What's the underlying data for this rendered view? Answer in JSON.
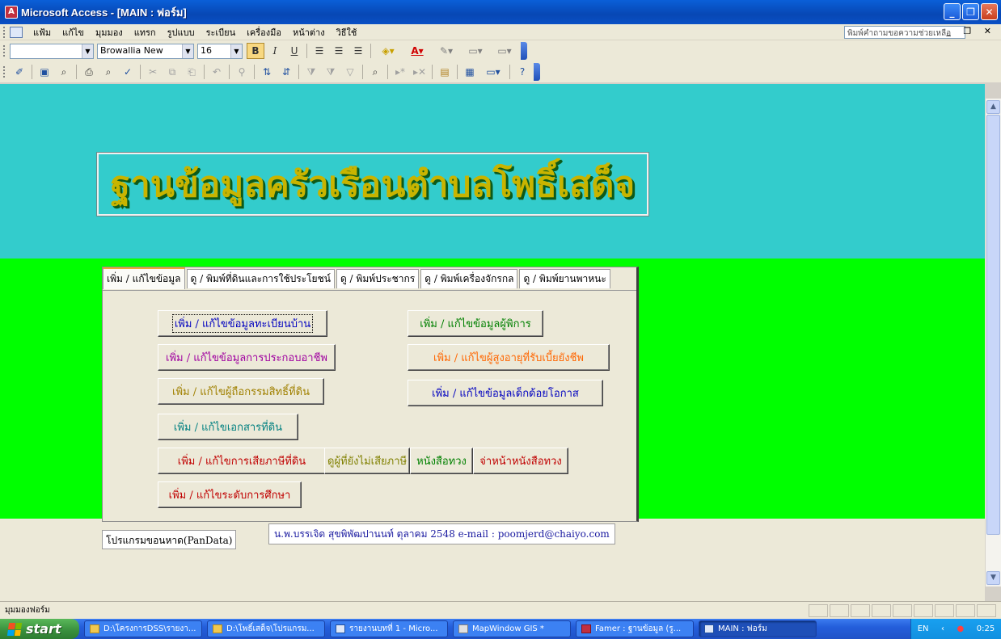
{
  "window": {
    "title": "Microsoft Access - [MAIN : ฟอร์ม]",
    "controls": {
      "minimize": "_",
      "restore": "❐",
      "close": "✕"
    }
  },
  "menubar": {
    "items": [
      "แฟ้ม",
      "แก้ไข",
      "มุมมอง",
      "แทรก",
      "รูปแบบ",
      "ระเบียน",
      "เครื่องมือ",
      "หน้าต่าง",
      "วิธีใช้"
    ],
    "help_placeholder": "พิมพ์คำถามขอความช่วยเหลือ",
    "doc_controls": "_ ❐ ✕"
  },
  "formatting_toolbar": {
    "object_combo": "",
    "font_name": "Browallia New",
    "font_size": "16",
    "bold": "B",
    "italic": "I",
    "underline": "U"
  },
  "form": {
    "title": "ฐานข้อมูลครัวเรือนตำบลโพธิ์เสด็จ",
    "tabs": [
      {
        "label": "เพิ่ม / แก้ไขข้อมูล",
        "active": true
      },
      {
        "label": "ดู / พิมพ์ที่ดินและการใช้ประโยชน์",
        "active": false
      },
      {
        "label": "ดู / พิมพ์ประชากร",
        "active": false
      },
      {
        "label": "ดู / พิมพ์เครื่องจักรกล",
        "active": false
      },
      {
        "label": "ดู / พิมพ์ยานพาหนะ",
        "active": false
      }
    ],
    "buttons": {
      "house_registry": {
        "label": "เพิ่ม / แก้ไขข้อมูลทะเบียนบ้าน",
        "color": "#0000c0"
      },
      "disabled": {
        "label": "เพิ่ม / แก้ไขข้อมูลผู้พิการ",
        "color": "#008000"
      },
      "occupation": {
        "label": "เพิ่ม / แก้ไขข้อมูลการประกอบอาชีพ",
        "color": "#a000a0"
      },
      "elderly_allowance": {
        "label": "เพิ่ม / แก้ไขผู้สูงอายุที่รับเบี้ยยังชีพ",
        "color": "#ff6600"
      },
      "land_owner": {
        "label": "เพิ่ม / แก้ไขผู้ถือกรรมสิทธิ์ที่ดิน",
        "color": "#a08000"
      },
      "underprivileged_children": {
        "label": "เพิ่ม / แก้ไขข้อมูลเด็กด้อยโอกาส",
        "color": "#0000c0"
      },
      "land_documents": {
        "label": "เพิ่ม / แก้ไขเอกสารที่ดิน",
        "color": "#008080"
      },
      "land_tax": {
        "label": "เพิ่ม / แก้ไขการเสียภาษีที่ดิน",
        "color": "#c00000"
      },
      "unpaid_tax": {
        "label": "ดูผู้ที่ยังไม่เสียภาษี",
        "color": "#808000"
      },
      "demand_letter": {
        "label": "หนังสือทวง",
        "color": "#008000"
      },
      "address_demand_letter": {
        "label": "จ่าหน้าหนังสือทวง",
        "color": "#c00000"
      },
      "education_level": {
        "label": "เพิ่ม / แก้ไขระดับการศึกษา",
        "color": "#c00000"
      }
    },
    "footer_program": "โปรแกรมขอนหาด(PanData)",
    "footer_credit": "น.พ.บรรเจิด สุขพิพัฒปานนท์ ตุลาคม 2548 e-mail : poomjerd@chaiyo.com"
  },
  "statusbar": {
    "text": "มุมมองฟอร์ม"
  },
  "taskbar": {
    "start": "start",
    "tasks": [
      {
        "label": "D:\\โครงการDSS\\รายงา...",
        "active": false
      },
      {
        "label": "D:\\โพธิ์เสด็จ\\โปรแกรม...",
        "active": false
      },
      {
        "label": "รายงานบทที่ 1 - Micro...",
        "active": false
      },
      {
        "label": "MapWindow GIS *",
        "active": false
      },
      {
        "label": "Famer : ฐานข้อมูล (รู...",
        "active": false
      },
      {
        "label": "MAIN : ฟอร์ม",
        "active": true
      }
    ],
    "lang": "EN",
    "time": "0:25"
  }
}
